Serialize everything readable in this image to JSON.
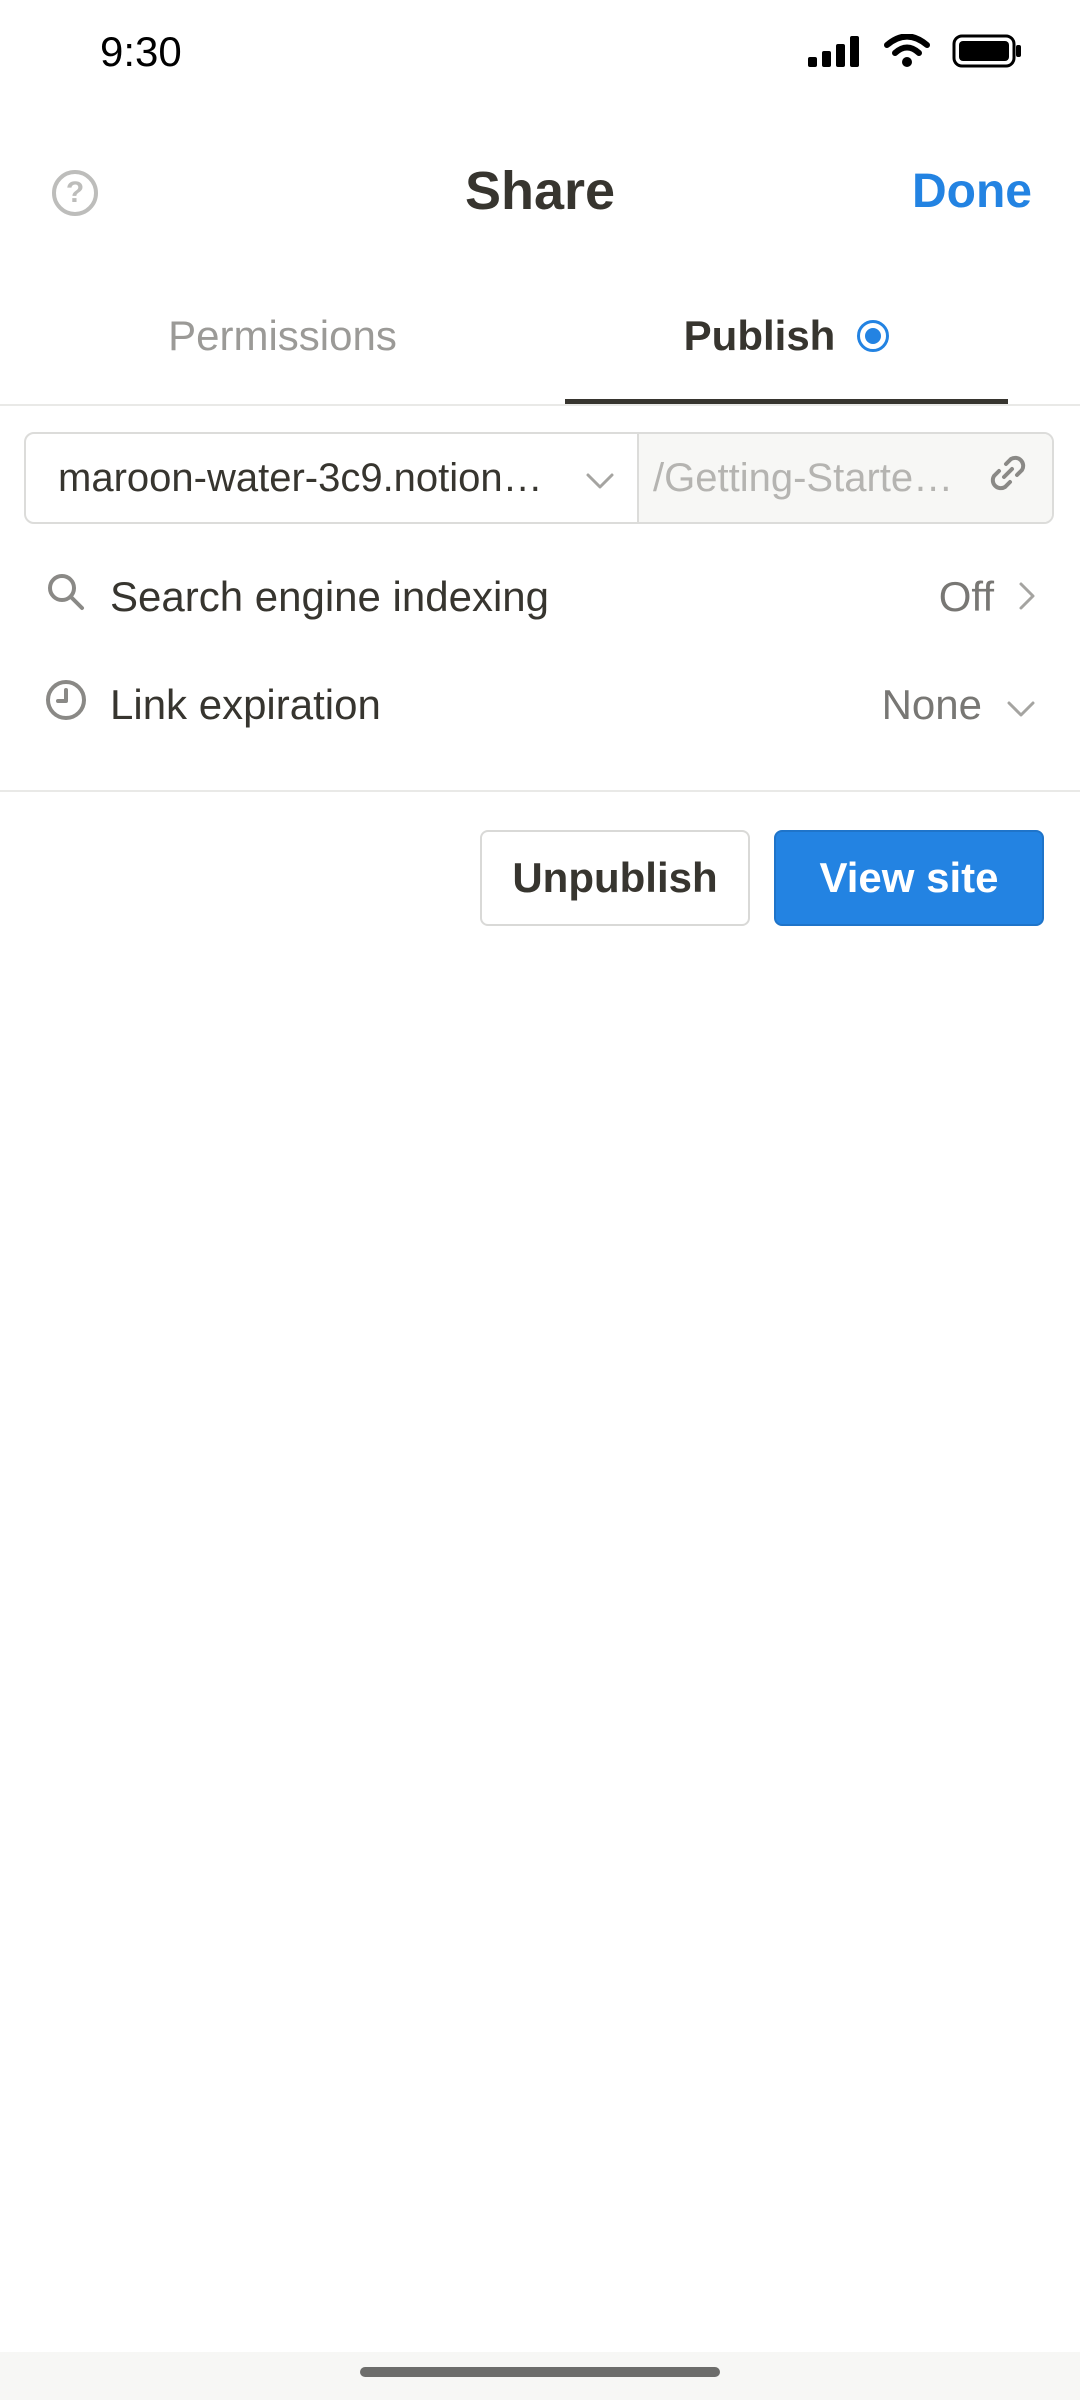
{
  "status_bar": {
    "time": "9:30"
  },
  "header": {
    "title": "Share",
    "done_label": "Done"
  },
  "tabs": [
    {
      "label": "Permissions",
      "active": false
    },
    {
      "label": "Publish",
      "active": true
    }
  ],
  "url": {
    "domain": "maroon-water-3c9.notion…",
    "path": "/Getting-Starte…"
  },
  "settings": {
    "search_indexing": {
      "label": "Search engine indexing",
      "value": "Off"
    },
    "link_expiration": {
      "label": "Link expiration",
      "value": "None"
    }
  },
  "actions": {
    "unpublish": "Unpublish",
    "view_site": "View site"
  },
  "colors": {
    "accent": "#2383e2",
    "text": "#37352f",
    "muted": "#9b9a97"
  }
}
